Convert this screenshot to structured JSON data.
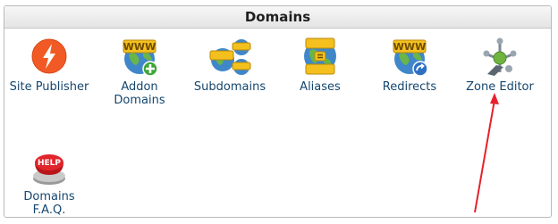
{
  "panel": {
    "title": "Domains"
  },
  "items": [
    {
      "label": "Site Publisher",
      "icon": "site-publisher-icon"
    },
    {
      "label": "Addon Domains",
      "icon": "addon-domains-icon"
    },
    {
      "label": "Subdomains",
      "icon": "subdomains-icon"
    },
    {
      "label": "Aliases",
      "icon": "aliases-icon"
    },
    {
      "label": "Redirects",
      "icon": "redirects-icon"
    },
    {
      "label": "Zone Editor",
      "icon": "zone-editor-icon"
    },
    {
      "label": "Domains F.A.Q.",
      "icon": "help-button-icon"
    }
  ],
  "badges": {
    "www": "WWW",
    "help": "HELP"
  },
  "colors": {
    "label_text": "#14466e",
    "arrow": "#e8202a",
    "site_publisher_orange": "#f15a24"
  }
}
